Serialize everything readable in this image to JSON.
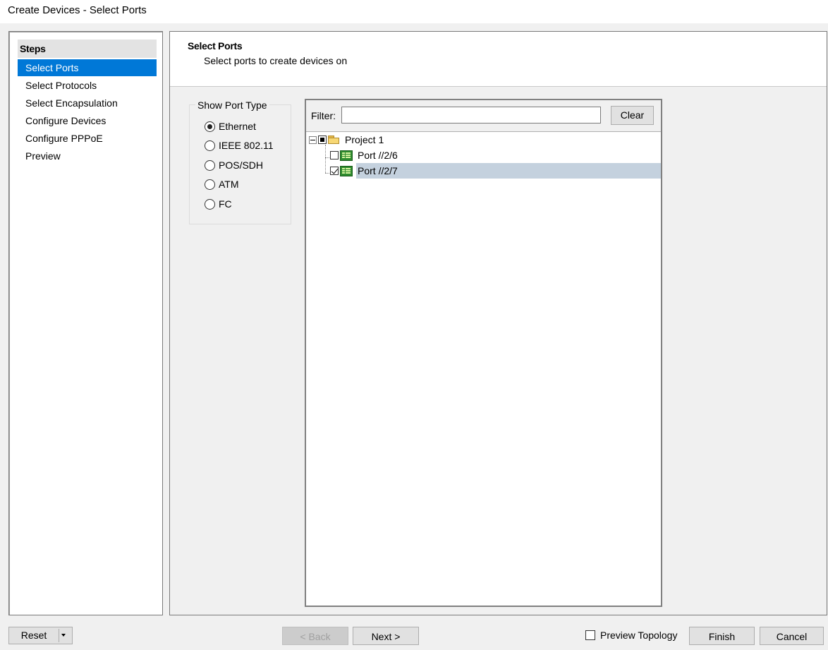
{
  "window": {
    "title": "Create Devices - Select Ports"
  },
  "steps": {
    "header": "Steps",
    "items": [
      {
        "label": "Select Ports",
        "selected": true
      },
      {
        "label": "Select Protocols",
        "selected": false
      },
      {
        "label": "Select Encapsulation",
        "selected": false
      },
      {
        "label": "Configure Devices",
        "selected": false
      },
      {
        "label": "Configure PPPoE",
        "selected": false
      },
      {
        "label": "Preview",
        "selected": false
      }
    ]
  },
  "main": {
    "title": "Select Ports",
    "subtitle": "Select ports to create devices on"
  },
  "port_type": {
    "legend": "Show Port Type",
    "options": [
      {
        "label": "Ethernet",
        "checked": true
      },
      {
        "label": "IEEE 802.11",
        "checked": false
      },
      {
        "label": "POS/SDH",
        "checked": false
      },
      {
        "label": "ATM",
        "checked": false
      },
      {
        "label": "FC",
        "checked": false
      }
    ]
  },
  "filter": {
    "label": "Filter:",
    "value": "",
    "clear_label": "Clear"
  },
  "tree": {
    "root": {
      "label": "Project 1",
      "state": "partial",
      "expanded": true,
      "icon": "folder-icon"
    },
    "children": [
      {
        "label": "Port //2/6",
        "checked": false,
        "icon": "port-icon"
      },
      {
        "label": "Port //2/7",
        "checked": true,
        "selected": true,
        "icon": "port-icon"
      }
    ]
  },
  "footer": {
    "reset_label": "Reset",
    "back_label": "< Back",
    "next_label": "Next >",
    "preview_topology_label": "Preview Topology",
    "preview_topology_checked": false,
    "finish_label": "Finish",
    "cancel_label": "Cancel"
  },
  "colors": {
    "selection": "#0078d7",
    "tree_selection": "#c4d1de",
    "window_bg": "#f0f0f0"
  }
}
